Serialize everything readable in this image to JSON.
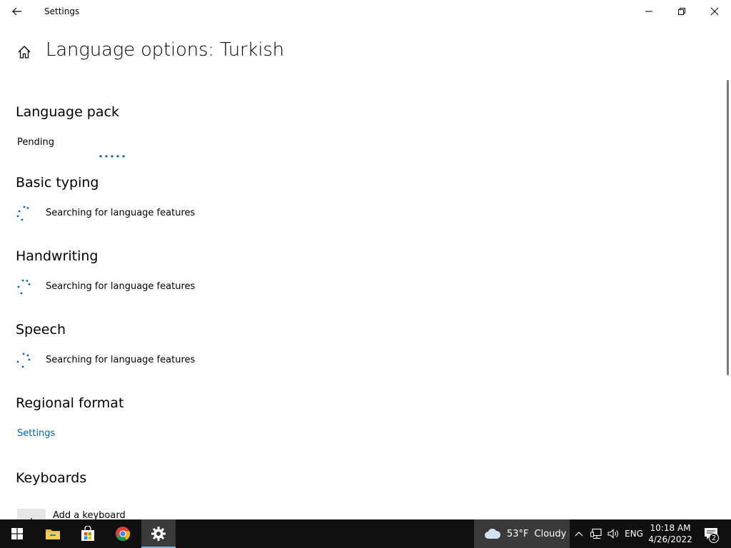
{
  "window": {
    "app_title": "Settings"
  },
  "header": {
    "page_title": "Language options: Turkish"
  },
  "sections": {
    "language_pack": {
      "heading": "Language pack",
      "status": "Pending"
    },
    "basic_typing": {
      "heading": "Basic typing",
      "status": "Searching for language features"
    },
    "handwriting": {
      "heading": "Handwriting",
      "status": "Searching for language features"
    },
    "speech": {
      "heading": "Speech",
      "status": "Searching for language features"
    },
    "regional_format": {
      "heading": "Regional format",
      "link": "Settings"
    },
    "keyboards": {
      "heading": "Keyboards",
      "add_label": "Add a keyboard"
    }
  },
  "taskbar": {
    "weather_temp": "53°F",
    "weather_desc": "Cloudy",
    "language": "ENG",
    "time": "10:18 AM",
    "date": "4/26/2022",
    "notification_count": "2"
  },
  "colors": {
    "accent": "#0067b8",
    "taskbar_bg": "#101010",
    "active_indicator": "#76b9ed"
  },
  "icons": {
    "back": "back-arrow-icon",
    "home": "home-icon",
    "minimize": "minimize-icon",
    "maximize": "restore-icon",
    "close": "close-icon",
    "spinner": "loading-spinner-icon",
    "start": "windows-start-icon",
    "explorer": "file-explorer-icon",
    "store": "microsoft-store-icon",
    "chrome": "chrome-icon",
    "settings": "gear-icon",
    "weather": "cloud-icon",
    "network": "network-icon",
    "volume": "volume-icon",
    "notifications": "action-center-icon"
  }
}
